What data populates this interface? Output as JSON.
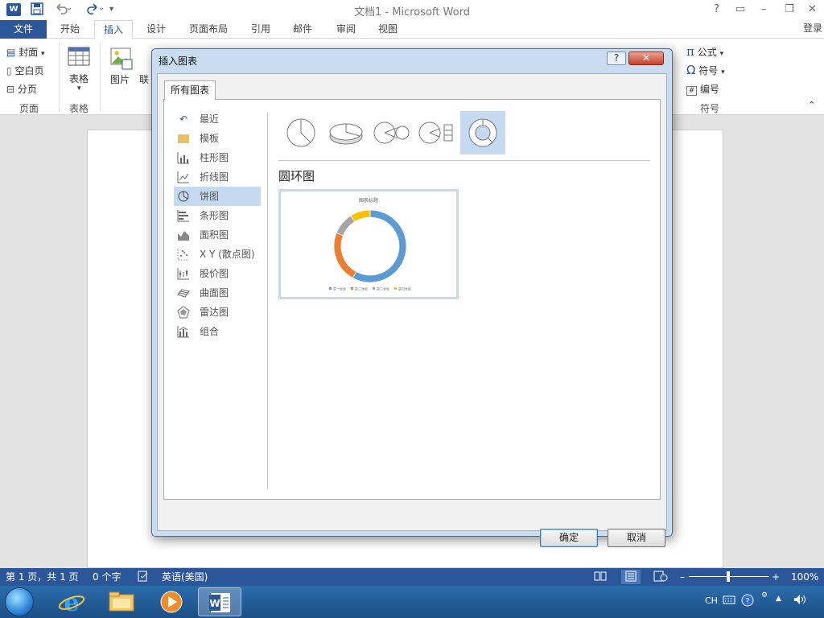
{
  "window": {
    "title": "文档1 - Microsoft Word",
    "app_logo": "W",
    "controls": [
      "?",
      "▭",
      "–",
      "❐",
      "✕"
    ]
  },
  "quick_access": {
    "save": "save-icon",
    "undo": "undo-icon",
    "redo": "redo-icon",
    "customize": "▾"
  },
  "tabs": [
    {
      "label": "文件"
    },
    {
      "label": "开始"
    },
    {
      "label": "插入"
    },
    {
      "label": "设计"
    },
    {
      "label": "页面布局"
    },
    {
      "label": "引用"
    },
    {
      "label": "邮件"
    },
    {
      "label": "审阅"
    },
    {
      "label": "视图"
    }
  ],
  "login": "登录",
  "ribbon": {
    "pages": {
      "cover": "封面",
      "blank": "空白页",
      "break": "分页",
      "group": "页面"
    },
    "tables": {
      "table": "表格",
      "group": "表格"
    },
    "illustrations": {
      "picture": "图片",
      "online": "联"
    },
    "symbols": {
      "equation": "公式",
      "symbol": "符号",
      "number": "编号",
      "group": "符号"
    }
  },
  "dialog": {
    "title": "插入图表",
    "help": "?",
    "close": "✕",
    "tab": "所有图表",
    "categories": [
      {
        "label": "最近"
      },
      {
        "label": "模板"
      },
      {
        "label": "柱形图"
      },
      {
        "label": "折线图"
      },
      {
        "label": "饼图"
      },
      {
        "label": "条形图"
      },
      {
        "label": "面积图"
      },
      {
        "label": "X Y (散点图)"
      },
      {
        "label": "股价图"
      },
      {
        "label": "曲面图"
      },
      {
        "label": "雷达图"
      },
      {
        "label": "组合"
      }
    ],
    "selected_category": 4,
    "selected_subtype": 4,
    "subtype_name": "圆环图",
    "preview": {
      "title": "图表标题",
      "legend": [
        "第一季度",
        "第二季度",
        "第三季度",
        "第四季度"
      ],
      "values": [
        58,
        23,
        10,
        9
      ],
      "colors": [
        "#5b9bd5",
        "#ed7d31",
        "#a5a5a5",
        "#ffc000"
      ]
    },
    "ok": "确定",
    "cancel": "取消"
  },
  "statusbar": {
    "page": "第 1 页，共 1 页",
    "words": "0 个字",
    "language": "英语(美国)",
    "zoom": "100%"
  },
  "taskbar": {
    "tray_lang": "CH"
  }
}
